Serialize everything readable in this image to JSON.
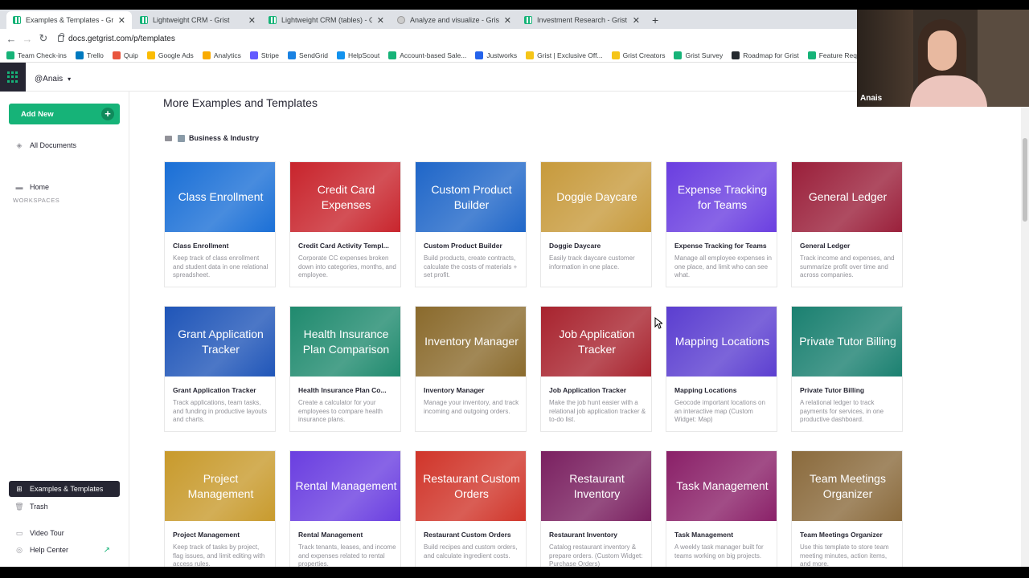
{
  "browser": {
    "tabs": [
      {
        "label": "Examples & Templates - Grist",
        "active": true
      },
      {
        "label": "Lightweight CRM - Grist",
        "active": false
      },
      {
        "label": "Lightweight CRM (tables) - Grist",
        "active": false
      },
      {
        "label": "Analyze and visualize - Grist Help",
        "active": false
      },
      {
        "label": "Investment Research - Grist",
        "active": false
      }
    ],
    "url": "docs.getgrist.com/p/templates",
    "bookmarks": [
      {
        "label": "Team Check-ins",
        "color": "#16b378"
      },
      {
        "label": "Trello",
        "color": "#0079bf"
      },
      {
        "label": "Quip",
        "color": "#e8553e"
      },
      {
        "label": "Google Ads",
        "color": "#fbbc04"
      },
      {
        "label": "Analytics",
        "color": "#f9ab00"
      },
      {
        "label": "Stripe",
        "color": "#635bff"
      },
      {
        "label": "SendGrid",
        "color": "#1a82e2"
      },
      {
        "label": "HelpScout",
        "color": "#1292ee"
      },
      {
        "label": "Account-based Sale...",
        "color": "#16b378"
      },
      {
        "label": "Justworks",
        "color": "#2463eb"
      },
      {
        "label": "Grist | Exclusive Off...",
        "color": "#f5c518"
      },
      {
        "label": "Grist Creators",
        "color": "#f5c518"
      },
      {
        "label": "Grist Survey",
        "color": "#16b378"
      },
      {
        "label": "Roadmap for Grist",
        "color": "#24292e"
      },
      {
        "label": "Feature Requests",
        "color": "#16b378"
      }
    ]
  },
  "app": {
    "org": "@Anais",
    "sidebar": {
      "add_new": "Add New",
      "all_documents": "All Documents",
      "workspaces_label": "WORKSPACES",
      "home": "Home",
      "examples": "Examples & Templates",
      "trash": "Trash",
      "video_tour": "Video Tour",
      "help_center": "Help Center"
    },
    "main": {
      "title": "More Examples and Templates",
      "category": "Business & Industry",
      "cards": [
        {
          "thumb": "Class Enrollment",
          "title": "Class Enrollment",
          "desc": "Keep track of class enrollment and student data in one relational spreadsheet.",
          "color": "#1a6fd6"
        },
        {
          "thumb": "Credit Card Expenses",
          "title": "Credit Card Activity Templ...",
          "desc": "Corporate CC expenses broken down into categories, months, and employee.",
          "color": "#c8242c"
        },
        {
          "thumb": "Custom Product Builder",
          "title": "Custom Product Builder",
          "desc": "Build products, create contracts, calculate the costs of materials + set profit.",
          "color": "#1f66c8"
        },
        {
          "thumb": "Doggie Daycare",
          "title": "Doggie Daycare",
          "desc": "Easily track daycare customer information in one place.",
          "color": "#c79a3c"
        },
        {
          "thumb": "Expense Tracking for Teams",
          "title": "Expense Tracking for Teams",
          "desc": "Manage all employee expenses in one place, and limit who can see what.",
          "color": "#6a3ee0"
        },
        {
          "thumb": "General Ledger",
          "title": "General Ledger",
          "desc": "Track income and expenses, and summarize profit over time and across companies.",
          "color": "#9a1f3a"
        },
        {
          "thumb": "Grant Application Tracker",
          "title": "Grant Application Tracker",
          "desc": "Track applications, team tasks, and funding in productive layouts and charts.",
          "color": "#1f55b8"
        },
        {
          "thumb": "Health Insurance Plan Comparison",
          "title": "Health Insurance Plan Co...",
          "desc": "Create a calculator for your employees to compare health insurance plans.",
          "color": "#1f8a6e"
        },
        {
          "thumb": "Inventory Manager",
          "title": "Inventory Manager",
          "desc": "Manage your inventory, and track incoming and outgoing orders.",
          "color": "#8a6a2c"
        },
        {
          "thumb": "Job Application Tracker",
          "title": "Job Application Tracker",
          "desc": "Make the job hunt easier with a relational job application tracker & to-do list.",
          "color": "#a8232e"
        },
        {
          "thumb": "Mapping Locations",
          "title": "Mapping Locations",
          "desc": "Geocode important locations on an interactive map (Custom Widget: Map)",
          "color": "#5b3ed0"
        },
        {
          "thumb": "Private Tutor Billing",
          "title": "Private Tutor Billing",
          "desc": "A relational ledger to track payments for services, in one productive dashboard.",
          "color": "#1a8070"
        },
        {
          "thumb": "Project Management",
          "title": "Project Management",
          "desc": "Keep track of tasks by project, flag issues, and limit editing with access rules.",
          "color": "#c89a2c"
        },
        {
          "thumb": "Rental Management",
          "title": "Rental Management",
          "desc": "Track tenants, leases, and income and expenses related to rental properties.",
          "color": "#6a3ee0"
        },
        {
          "thumb": "Restaurant Custom Orders",
          "title": "Restaurant Custom Orders",
          "desc": "Build recipes and custom orders, and calculate ingredient costs.",
          "color": "#d0352a"
        },
        {
          "thumb": "Restaurant Inventory",
          "title": "Restaurant Inventory",
          "desc": "Catalog restaurant inventory & prepare orders. (Custom Widget: Purchase Orders)",
          "color": "#7a2060"
        },
        {
          "thumb": "Task Management",
          "title": "Task Management",
          "desc": "A weekly task manager built for teams working on big projects.",
          "color": "#8a2068"
        },
        {
          "thumb": "Team Meetings Organizer",
          "title": "Team Meetings Organizer",
          "desc": "Use this template to store team meeting minutes, action items, and more.",
          "color": "#8a6a3c"
        }
      ]
    }
  },
  "webcam": {
    "name": "Anais"
  }
}
